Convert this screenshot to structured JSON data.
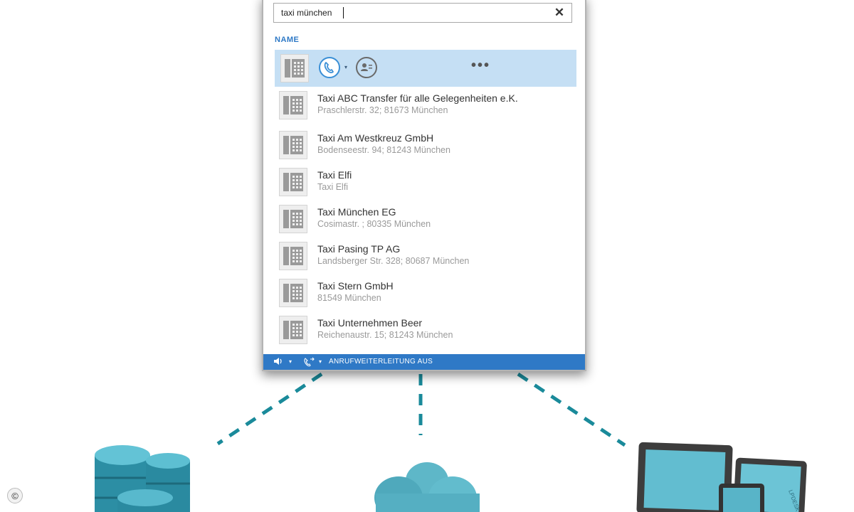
{
  "search": {
    "value": "taxi münchen",
    "clear_symbol": "✕"
  },
  "list": {
    "section_label": "NAME",
    "more_label": "•••",
    "contacts": [
      {
        "name": "Taxi ABC Transfer für alle Gelegenheiten e.K.",
        "address": "Praschlerstr. 32; 81673 München"
      },
      {
        "name": "Taxi Am Westkreuz GmbH",
        "address": "Bodenseestr. 94; 81243 München"
      },
      {
        "name": "Taxi Elfi",
        "address": "Taxi Elfi"
      },
      {
        "name": "Taxi München EG",
        "address": "Cosimastr. ; 80335 München"
      },
      {
        "name": "Taxi Pasing TP AG",
        "address": "Landsberger Str. 328; 80687 München"
      },
      {
        "name": "Taxi Stern GmbH",
        "address": "81549 München"
      },
      {
        "name": "Taxi Unternehmen Beer",
        "address": "Reichenaustr. 15; 81243 München"
      }
    ]
  },
  "status_bar": {
    "call_forwarding_label": "ANRUFWEITERLEITUNG AUS",
    "dropdown_symbol": "▾"
  },
  "footer": {
    "copyright_symbol": "©"
  },
  "icons": {
    "phone-tile": "desk-phone-icon",
    "call": "phone-handset-icon",
    "contact-card": "contact-card-icon",
    "database": "database-icon",
    "cloud": "cloud-icon",
    "devices": "tablet-devices-icon"
  },
  "colors": {
    "accent": "#2f79c6",
    "selected_row": "#c5dff4",
    "connector": "#1a8a9a",
    "device_teal": "#4fb3c6"
  }
}
